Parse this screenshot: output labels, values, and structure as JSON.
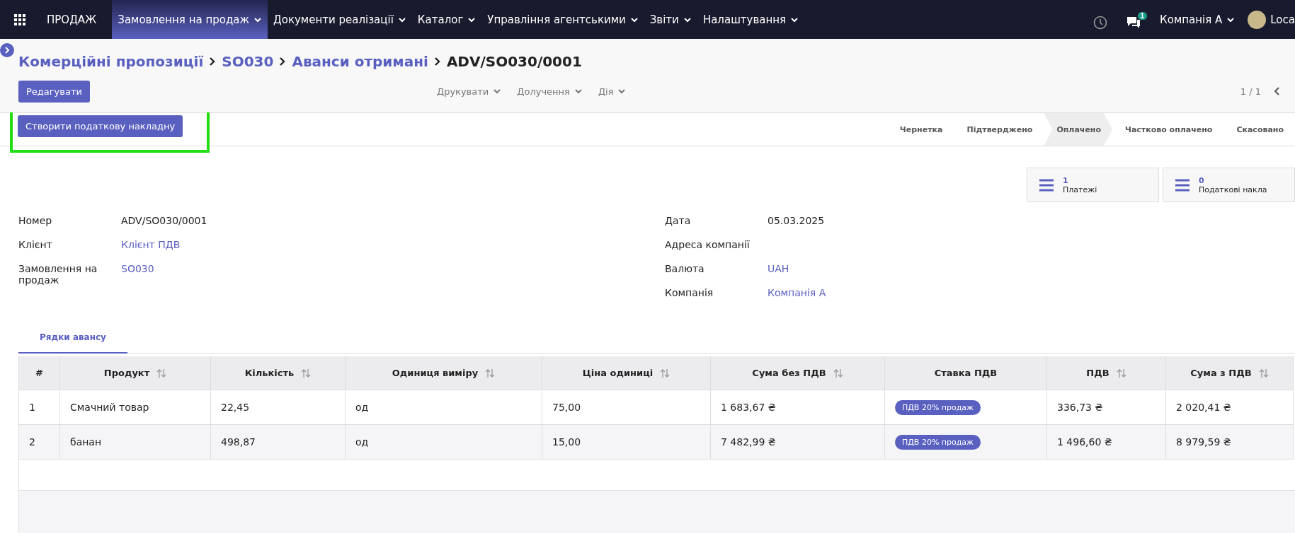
{
  "navbar": {
    "app_name": "ПРОДАЖ",
    "menus": [
      {
        "label": "Замовлення на продаж",
        "selected": true
      },
      {
        "label": "Документи реалізації",
        "selected": false
      },
      {
        "label": "Каталог",
        "selected": false
      },
      {
        "label": "Управління агентськими",
        "selected": false
      },
      {
        "label": "Звіти",
        "selected": false
      },
      {
        "label": "Налаштування",
        "selected": false
      }
    ],
    "messages_count": "1",
    "company": "Компанія А",
    "user": "Loca"
  },
  "breadcrumb": [
    {
      "label": "Комерційні пропозиції",
      "kind": "link"
    },
    {
      "label": "SO030",
      "kind": "link"
    },
    {
      "label": "Аванси отримані",
      "kind": "link"
    },
    {
      "label": "ADV/SO030/0001",
      "kind": "current"
    }
  ],
  "edit_button": "Редагувати",
  "dropdowns": [
    "Друкувати",
    "Долучення",
    "Дія"
  ],
  "pager": "1 / 1",
  "action_button": {
    "label": "Створити податкову накладну",
    "highlighted": true
  },
  "statuses": [
    {
      "label": "Чернетка",
      "selected": false
    },
    {
      "label": "Підтверджено",
      "selected": false
    },
    {
      "label": "Оплачено",
      "selected": true
    },
    {
      "label": "Частково оплачено",
      "selected": false
    },
    {
      "label": "Скасовано",
      "selected": false
    }
  ],
  "smart_buttons": [
    {
      "count": "1",
      "label": "Платежі"
    },
    {
      "count": "0",
      "label": "Податкові накла"
    }
  ],
  "fields_left": [
    {
      "label": "Номер",
      "value": "ADV/SO030/0001",
      "kind": "text"
    },
    {
      "label": "Клієнт",
      "value": "Клієнт ПДВ",
      "kind": "link"
    },
    {
      "label": "Замовлення на продаж",
      "value": "SO030",
      "kind": "link"
    }
  ],
  "fields_right": [
    {
      "label": "Дата",
      "value": "05.03.2025",
      "kind": "text"
    },
    {
      "label": "Адреса компанії"
    },
    {
      "label": "Валюта",
      "value": "UAH",
      "kind": "link"
    },
    {
      "label": "Компанія",
      "value": "Компанія А",
      "kind": "link"
    }
  ],
  "tabs": [
    {
      "label": "Рядки авансу",
      "selected": true
    }
  ],
  "table": {
    "columns": [
      {
        "label": "#",
        "sortable": false
      },
      {
        "label": "Продукт",
        "sortable": true
      },
      {
        "label": "Кількість",
        "sortable": true
      },
      {
        "label": "Одиниця виміру",
        "sortable": true
      },
      {
        "label": "Ціна одиниці",
        "sortable": true
      },
      {
        "label": "Сума без ПДВ",
        "sortable": true
      },
      {
        "label": "Ставка ПДВ",
        "sortable": false
      },
      {
        "label": "ПДВ",
        "sortable": true
      },
      {
        "label": "Сума з ПДВ",
        "sortable": true
      }
    ],
    "rows": [
      {
        "cells": [
          {
            "kind": "text",
            "text": "1"
          },
          {
            "kind": "text",
            "text": "Смачний товар"
          },
          {
            "kind": "text",
            "text": "22,45"
          },
          {
            "kind": "text",
            "text": "од"
          },
          {
            "kind": "text",
            "text": "75,00"
          },
          {
            "kind": "text",
            "text": "1 683,67 ₴"
          },
          {
            "kind": "tag",
            "text": "ПДВ 20% продаж"
          },
          {
            "kind": "text",
            "text": "336,73 ₴"
          },
          {
            "kind": "text",
            "text": "2 020,41 ₴"
          }
        ]
      },
      {
        "cells": [
          {
            "kind": "text",
            "text": "2"
          },
          {
            "kind": "text",
            "text": "банан"
          },
          {
            "kind": "text",
            "text": "498,87"
          },
          {
            "kind": "text",
            "text": "од"
          },
          {
            "kind": "text",
            "text": "15,00"
          },
          {
            "kind": "text",
            "text": "7 482,99 ₴"
          },
          {
            "kind": "tag",
            "text": "ПДВ 20% продаж"
          },
          {
            "kind": "text",
            "text": "1 496,60 ₴"
          },
          {
            "kind": "text",
            "text": "8 979,59 ₴"
          }
        ]
      }
    ]
  }
}
